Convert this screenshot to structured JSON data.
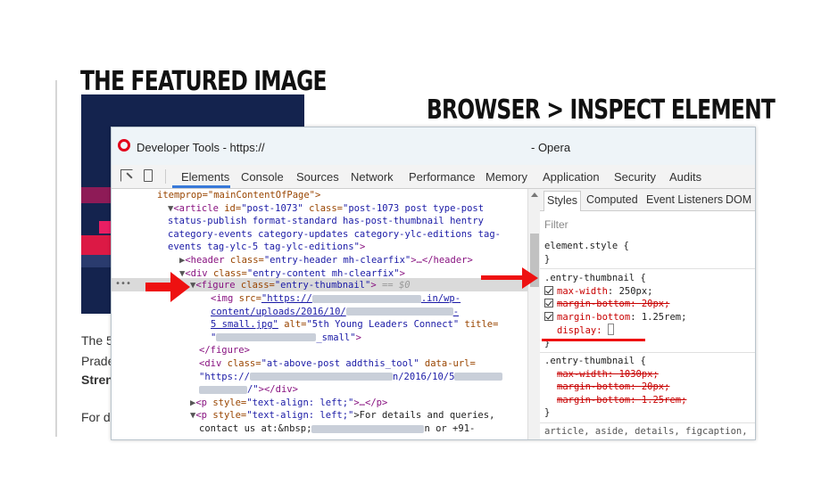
{
  "article": {
    "heading_featured": "THE FEATURED IMAGE",
    "heading_inspect": "BROWSER > INSPECT ELEMENT",
    "text_line1": "The 5",
    "text_line2": "Prade",
    "text_line3": "Stren",
    "text_line4": "For d"
  },
  "devtools": {
    "title_left": "Developer Tools - https://",
    "title_right": "- Opera",
    "tabs": [
      "Elements",
      "Console",
      "Sources",
      "Network",
      "Performance",
      "Memory",
      "Application",
      "Security",
      "Audits"
    ],
    "active_tab": "Elements",
    "dom": {
      "l0": "itemprop=\"mainContentOfPage\">",
      "l1_tag": "<article",
      "l1_a1": "id=",
      "l1_v1": "\"post-1073\"",
      "l1_a2": "class=",
      "l1_v2a": "\"post-1073 post type-post",
      "l2": "status-publish format-standard has-post-thumbnail hentry",
      "l3": "category-events category-updates category-ylc-editions tag-",
      "l4": "events tag-ylc-5 tag-ylc-editions\"",
      "l4_end": ">",
      "l5_tag": "<header",
      "l5_a": "class=",
      "l5_v": "\"entry-header mh-clearfix\"",
      "l5_mid": ">…</",
      "l5_close": "header>",
      "l6_tag": "<div",
      "l6_a": "class=",
      "l6_v": "\"entry-content mh-clearfix\"",
      "l6_end": ">",
      "l7_tag": "<figure",
      "l7_a": "class=",
      "l7_v": "\"entry-thumbnail\"",
      "l7_end": ">",
      "l7_eq": "== $0",
      "l8_tag": "<img",
      "l8_a": "src=",
      "l8_v1": "\"https://",
      "l8_v2": ".in/wp-",
      "l9_v1": "content/uploads/2016/10/",
      "l9_v2": "-",
      "l10_v1": "5 small.jpg\"",
      "l10_a": "alt=",
      "l10_v2": "\"5th Young Leaders Connect\"",
      "l10_a2": "title=",
      "l11_v1": "\"",
      "l11_v2": "_small\"",
      "l11_end": ">",
      "l12": "</figure>",
      "l13_tag": "<div",
      "l13_a": "class=",
      "l13_v": "\"at-above-post addthis_tool\"",
      "l13_a2": "data-url=",
      "l14_v1": "\"https://",
      "l14_v2": "n/2016/10/5",
      "l15_v2": "/\"",
      "l15_end": "></div>",
      "l16_tag": "<p",
      "l16_a": "style=",
      "l16_v": "\"text-align: left;\"",
      "l16_end": ">…</p>",
      "l17_tag": "<p",
      "l17_a": "style=",
      "l17_v": "\"text-align: left;\"",
      "l17_text": ">For details and queries,",
      "l18_text": "contact us at:",
      "l18_ent": "&nbsp;",
      "l18_tail": "n or +91-"
    },
    "styles_tabs": [
      "Styles",
      "Computed",
      "Event Listeners",
      "DOM"
    ],
    "filter_placeholder": "Filter",
    "element_style": "element.style {",
    "rule1_selector": ".entry-thumbnail {",
    "rule1_props": [
      {
        "name": "max-width",
        "value": "250px;",
        "struck": false
      },
      {
        "name": "margin-bottom",
        "value": "20px;",
        "struck": true
      },
      {
        "name": "margin-bottom",
        "value": "1.25rem;",
        "struck": false
      }
    ],
    "rule1_new_prop": "display:",
    "rule2_selector": ".entry-thumbnail {",
    "rule2_props": [
      {
        "name": "max-width",
        "value": "1030px;"
      },
      {
        "name": "margin-bottom",
        "value": "20px;"
      },
      {
        "name": "margin-bottom",
        "value": "1.25rem;"
      }
    ],
    "close_brace": "}",
    "next_selector": "article, aside, details, figcaption,",
    "dots": "•••"
  },
  "colors": {
    "annotation_red": "#ee1111",
    "opera_red": "#e2001a",
    "tag_purple": "#881280",
    "attr_brown": "#994500",
    "value_blue": "#1a1aa6",
    "featured_navy": "#14234e"
  }
}
